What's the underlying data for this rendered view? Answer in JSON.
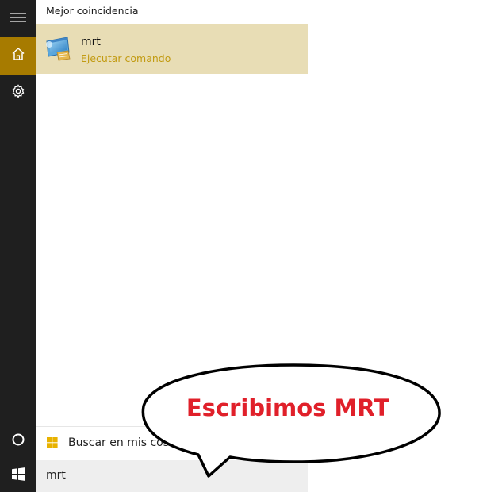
{
  "rail": {
    "items": [
      {
        "name": "menu",
        "icon": "hamburger-menu-icon"
      },
      {
        "name": "home",
        "icon": "home-icon",
        "active": true
      },
      {
        "name": "settings",
        "icon": "gear-icon"
      },
      {
        "name": "cortana",
        "icon": "cortana-circle-icon"
      },
      {
        "name": "start",
        "icon": "windows-logo-icon"
      }
    ],
    "active_color": "#a77b00"
  },
  "results": {
    "section_title": "Mejor coincidencia",
    "best_match": {
      "name": "mrt",
      "subtitle": "Ejecutar comando",
      "icon": "app-window-icon",
      "highlight_color": "#e8ddb5",
      "subtitle_color": "#c29b12"
    }
  },
  "search_mine": {
    "label": "Buscar en mis cosas",
    "icon": "windows-logo-icon"
  },
  "search": {
    "value": "mrt"
  },
  "annotation": {
    "text": "Escribimos MRT",
    "color": "#e0202a"
  }
}
